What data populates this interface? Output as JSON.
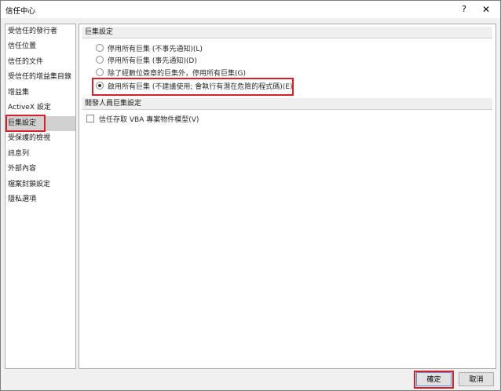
{
  "window": {
    "title": "信任中心",
    "help_glyph": "?",
    "close_glyph": "✕"
  },
  "sidebar": {
    "items": [
      {
        "label": "受信任的發行者"
      },
      {
        "label": "信任位置"
      },
      {
        "label": "信任的文件"
      },
      {
        "label": "受信任的增益集目錄"
      },
      {
        "label": "增益集"
      },
      {
        "label": "ActiveX 設定"
      },
      {
        "label": "巨集設定"
      },
      {
        "label": "受保護的檢視"
      },
      {
        "label": "訊息列"
      },
      {
        "label": "外部內容"
      },
      {
        "label": "檔案封鎖設定"
      },
      {
        "label": "隱私選項"
      }
    ],
    "selected_index": 6
  },
  "macro_settings": {
    "header": "巨集設定",
    "options": [
      {
        "label": "停用所有巨集 (不事先通知)(L)",
        "checked": false
      },
      {
        "label": "停用所有巨集 (事先通知)(D)",
        "checked": false
      },
      {
        "label": "除了經數位簽章的巨集外，停用所有巨集(G)",
        "checked": false
      },
      {
        "label": "啟用所有巨集 (不建議使用; 會執行有潛在危險的程式碼)(E)",
        "checked": true
      }
    ]
  },
  "developer_settings": {
    "header": "開發人員巨集設定",
    "checkbox_label": "信任存取 VBA 專案物件模型(V)",
    "checked": false
  },
  "buttons": {
    "ok": "確定",
    "cancel": "取消"
  },
  "colors": {
    "highlight": "#d6202a",
    "selected_bg": "#d1d1d1"
  }
}
